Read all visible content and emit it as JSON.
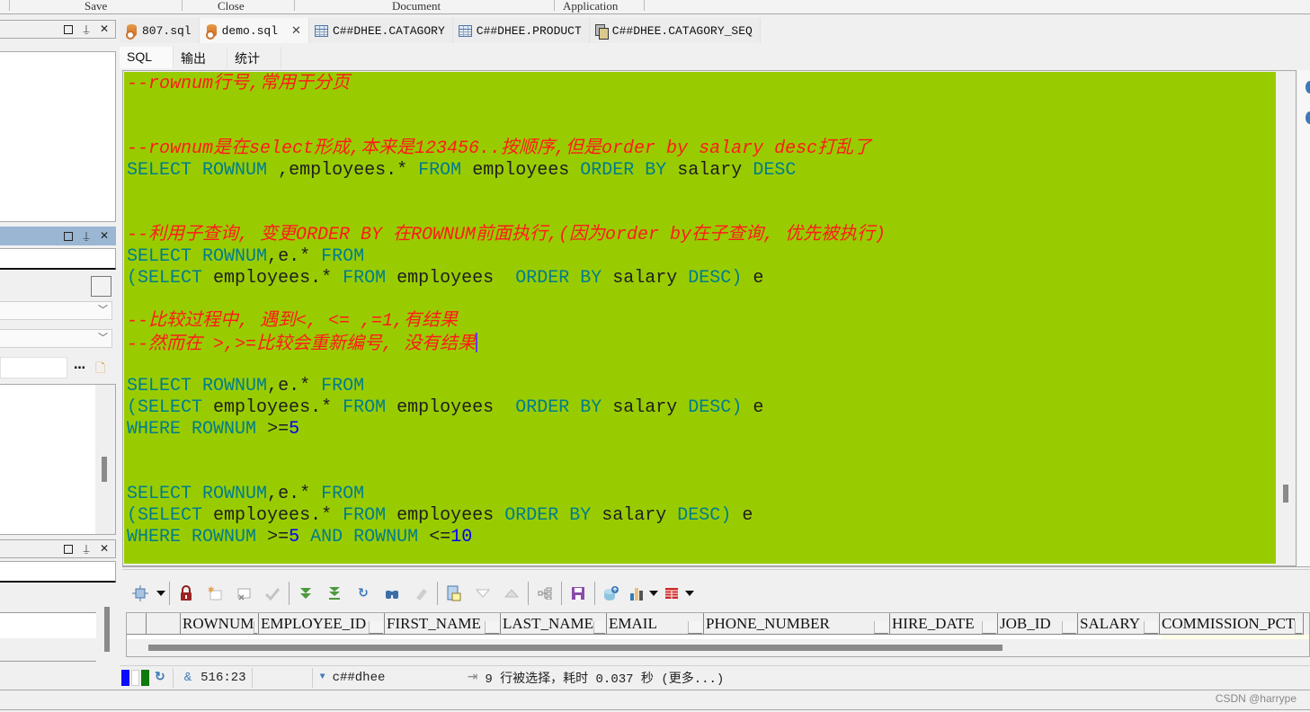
{
  "ribbon": {
    "groups": [
      "Save",
      "Close",
      "Document",
      "Application"
    ]
  },
  "tabs": [
    {
      "label": "807.sql",
      "icon": "sql-file-icon",
      "active": false
    },
    {
      "label": "demo.sql",
      "icon": "sql-file-icon",
      "active": true,
      "close": "✕"
    },
    {
      "label": "C##DHEE.CATAGORY",
      "icon": "table-icon",
      "active": false
    },
    {
      "label": "C##DHEE.PRODUCT",
      "icon": "table-icon",
      "active": false
    },
    {
      "label": "C##DHEE.CATAGORY_SEQ",
      "icon": "sequence-icon",
      "active": false
    }
  ],
  "subtabs": [
    "SQL",
    "输出",
    "统计"
  ],
  "editor": {
    "background": "#99cc00",
    "lines": [
      "--rownum行号,常用于分页",
      "",
      "",
      "--rownum是在select形成,本来是123456..按顺序,但是order by salary desc打乱了",
      "SELECT ROWNUM ,employees.* FROM employees ORDER BY salary DESC",
      "",
      "",
      "--利用子查询, 变更ORDER BY 在ROWNUM前面执行,(因为order by在子查询, 优先被执行)",
      "SELECT ROWNUM,e.* FROM",
      "(SELECT employees.* FROM employees  ORDER BY salary DESC) e",
      "",
      "--比较过程中, 遇到<, <= ,=1,有结果",
      "--然而在 >,>=比较会重新编号, 没有结果",
      "",
      "SELECT ROWNUM,e.* FROM",
      "(SELECT employees.* FROM employees  ORDER BY salary DESC) e",
      "WHERE ROWNUM >=5",
      "",
      "",
      "SELECT ROWNUM,e.* FROM",
      "(SELECT employees.* FROM employees ORDER BY salary DESC) e",
      "WHERE ROWNUM >=5 AND ROWNUM <=10"
    ],
    "cursor_line": 12
  },
  "colors": {
    "comment": "#ff1a1a",
    "keyword": "#007d8c",
    "identifier": "#1e1e1e",
    "number": "#0000ff",
    "active_panel": "#9ab6d3"
  },
  "toolbar": {
    "buttons": [
      "select-mode-icon",
      "dropdown",
      "lock-icon",
      "insert-row-icon",
      "delete-row-icon",
      "commit-check-icon",
      "fetch-next-icon",
      "fetch-all-icon",
      "refresh-icon",
      "find-icon",
      "clear-icon",
      "record-view-icon",
      "sort-down-icon",
      "sort-up-icon",
      "query-plan-icon",
      "save-icon",
      "export-icon",
      "chart-icon",
      "dropdown",
      "grid-view-icon",
      "dropdown"
    ]
  },
  "grid": {
    "columns": [
      "ROWNUM",
      "EMPLOYEE_ID",
      "FIRST_NAME",
      "LAST_NAME",
      "EMAIL",
      "PHONE_NUMBER",
      "HIRE_DATE",
      "JOB_ID",
      "SALARY",
      "COMMISSION_PCT"
    ]
  },
  "status": {
    "position": "516:23",
    "connection": "c##dhee",
    "message": "9 行被选择，耗时 0.037 秒 (更多...)"
  },
  "watermark": "CSDN @harrype"
}
